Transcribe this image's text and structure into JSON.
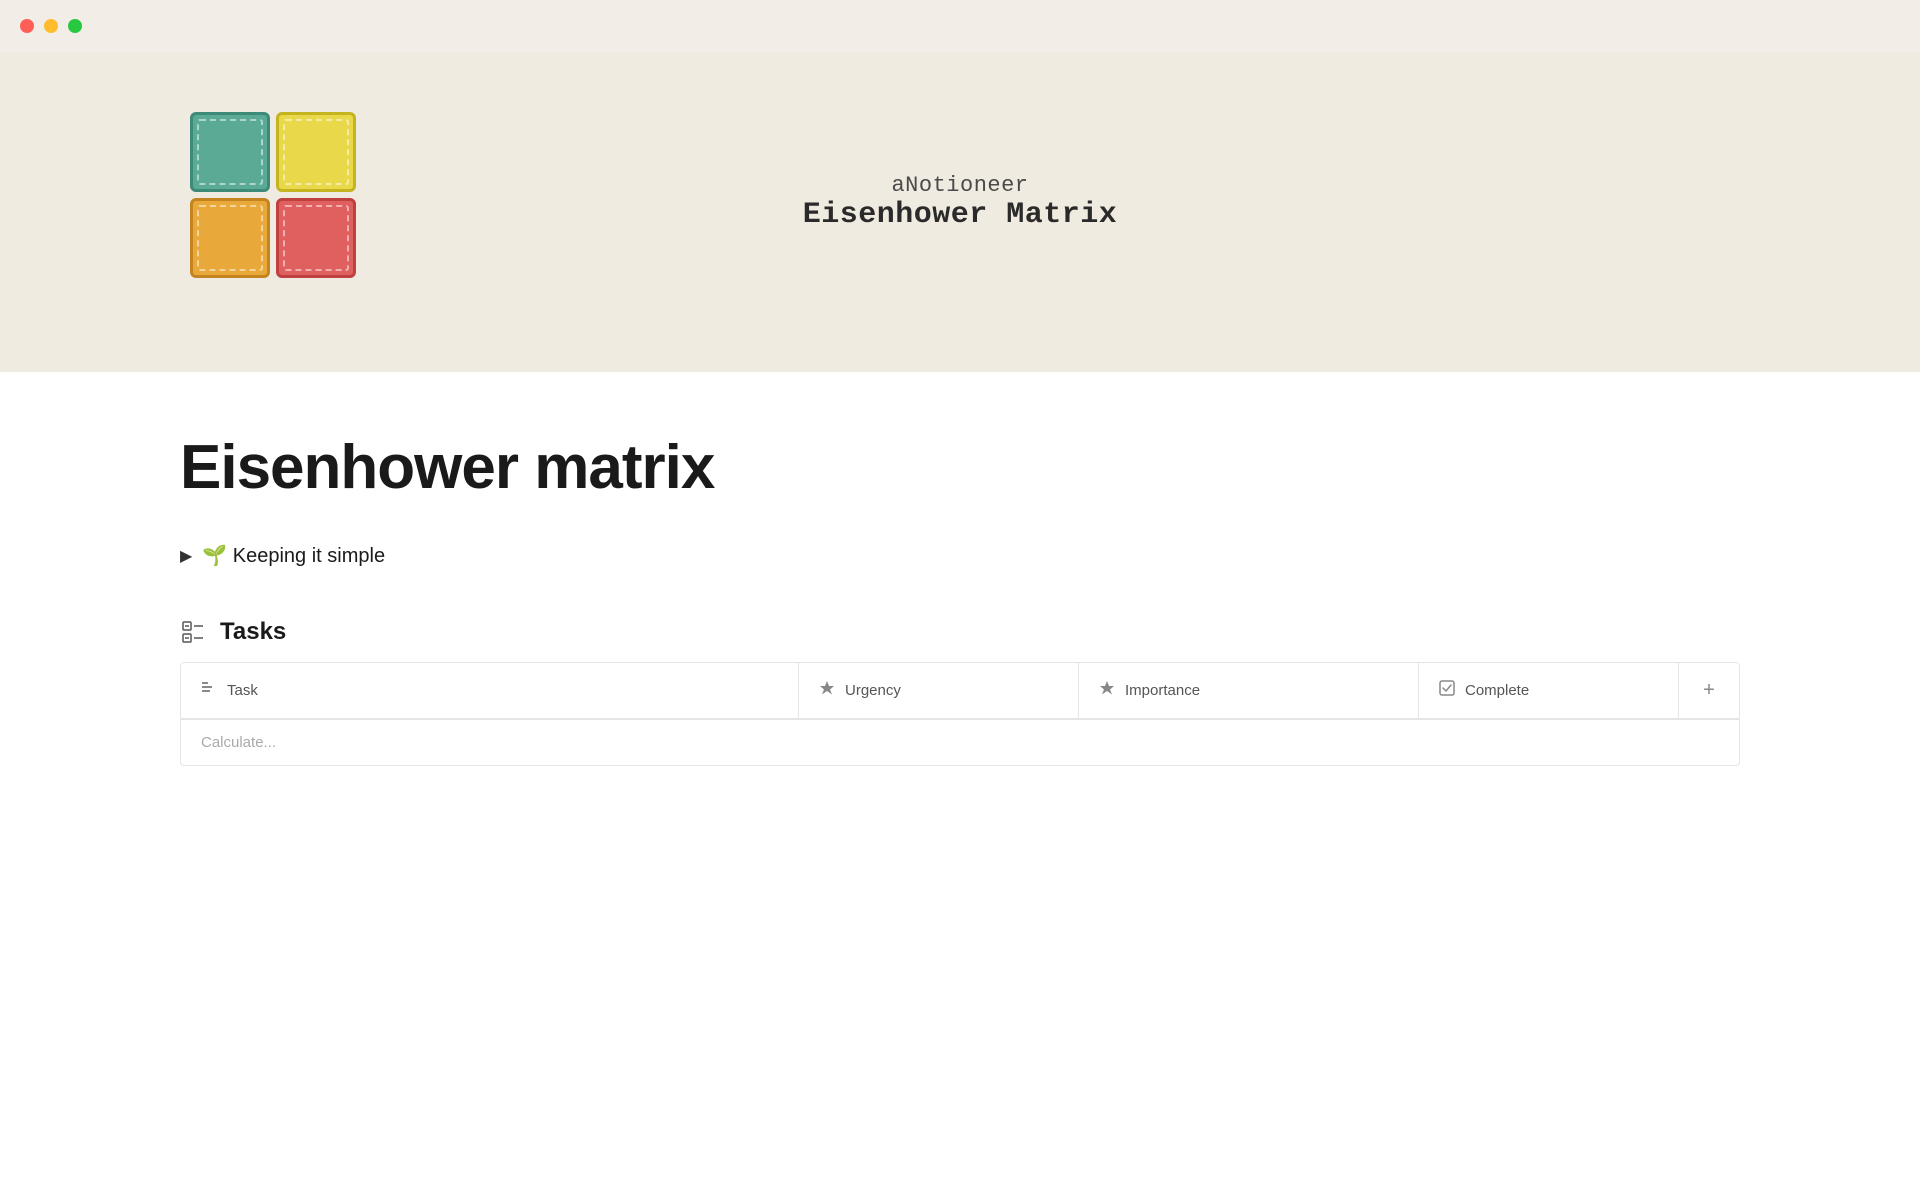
{
  "window": {
    "traffic_lights": {
      "close": "close",
      "minimize": "minimize",
      "maximize": "maximize"
    }
  },
  "hero": {
    "subtitle": "aNotioneer",
    "title": "Eisenhower Matrix",
    "matrix_cells": [
      {
        "color": "teal",
        "position": "top-left"
      },
      {
        "color": "yellow",
        "position": "top-right"
      },
      {
        "color": "orange",
        "position": "bottom-left"
      },
      {
        "color": "red",
        "position": "bottom-right"
      }
    ]
  },
  "page": {
    "title": "Eisenhower matrix"
  },
  "collapsed_section": {
    "emoji": "🌱",
    "label": "Keeping it simple"
  },
  "tasks_section": {
    "title": "Tasks",
    "columns": [
      {
        "id": "task",
        "label": "Task",
        "icon": "text-icon"
      },
      {
        "id": "urgency",
        "label": "Urgency",
        "icon": "shield-icon"
      },
      {
        "id": "importance",
        "label": "Importance",
        "icon": "shield-icon"
      },
      {
        "id": "complete",
        "label": "Complete",
        "icon": "checkbox-icon"
      }
    ],
    "add_button_label": "+",
    "bottom_hint": "Calculate..."
  }
}
